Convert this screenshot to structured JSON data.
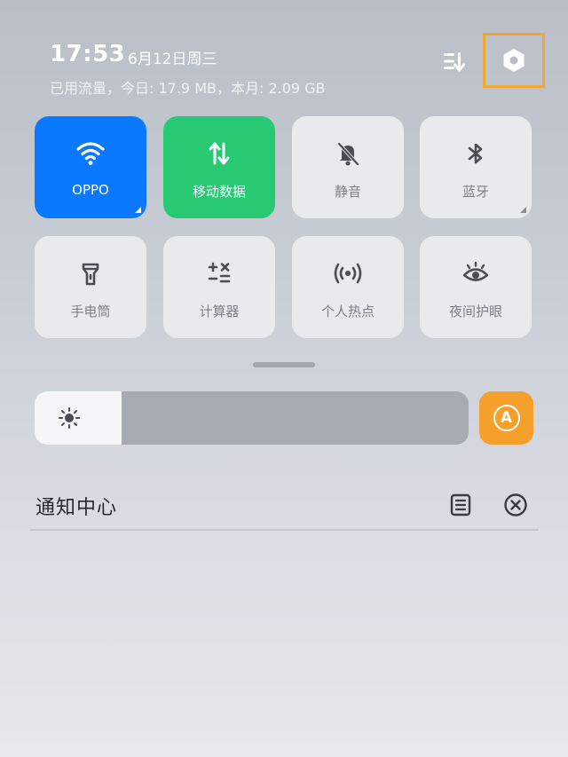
{
  "status": {
    "time": "17:53",
    "date": "6月12日周三",
    "data_usage": "已用流量，今日: 17.9 MB，本月: 2.09 GB"
  },
  "header_actions": {
    "edit_icon": "sort-edit-icon",
    "settings_icon": "hexagon-settings-icon"
  },
  "tiles": [
    {
      "label": "OPPO",
      "icon": "wifi-icon",
      "state": "on",
      "color": "#0A78FF",
      "has_more": true
    },
    {
      "label": "移动数据",
      "icon": "mobile-data-icon",
      "state": "on",
      "color": "#27C973",
      "has_more": false
    },
    {
      "label": "静音",
      "icon": "bell-off-icon",
      "state": "off",
      "has_more": false
    },
    {
      "label": "蓝牙",
      "icon": "bluetooth-icon",
      "state": "off",
      "has_more": true
    },
    {
      "label": "手电筒",
      "icon": "flashlight-icon",
      "state": "off"
    },
    {
      "label": "计算器",
      "icon": "calculator-icon",
      "state": "off"
    },
    {
      "label": "个人热点",
      "icon": "hotspot-icon",
      "state": "off"
    },
    {
      "label": "夜间护眼",
      "icon": "eye-icon",
      "state": "off"
    }
  ],
  "brightness": {
    "level": 0.2,
    "icon": "sun-icon",
    "auto_label": "A",
    "auto_color": "#F4A02B"
  },
  "notifications": {
    "title": "通知中心",
    "manage_icon": "notification-manage-icon",
    "clear_icon": "clear-all-icon"
  }
}
